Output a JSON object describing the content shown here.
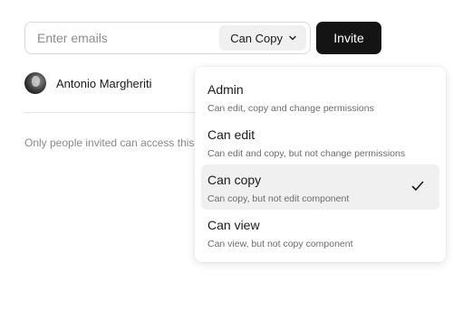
{
  "invite": {
    "email_placeholder": "Enter emails",
    "permission_selected": "Can Copy",
    "invite_label": "Invite"
  },
  "member": {
    "name": "Antonio Margheriti"
  },
  "note": "Only people invited can access this",
  "dropdown": {
    "options": [
      {
        "title": "Admin",
        "description": "Can edit, copy and change permissions",
        "selected": false
      },
      {
        "title": "Can edit",
        "description": "Can edit and copy, but not change permissions",
        "selected": false
      },
      {
        "title": "Can copy",
        "description": "Can copy, but not edit component",
        "selected": true
      },
      {
        "title": "Can view",
        "description": "Can view, but not copy component",
        "selected": false
      }
    ]
  },
  "icons": {
    "select_caret": "chevron-down-icon",
    "selected_marker": "check-icon"
  }
}
